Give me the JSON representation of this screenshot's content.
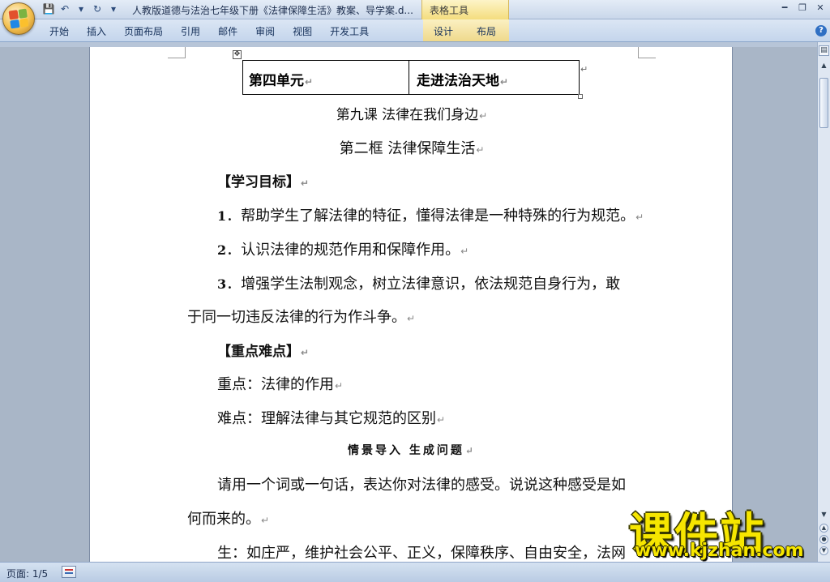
{
  "window": {
    "title": "人教版道德与法治七年级下册《法律保障生活》教案、导学案.d...",
    "context_tab_group": "表格工具"
  },
  "ribbon": {
    "tabs": [
      "开始",
      "插入",
      "页面布局",
      "引用",
      "邮件",
      "审阅",
      "视图",
      "开发工具"
    ],
    "context_tabs": [
      "设计",
      "布局"
    ]
  },
  "document": {
    "table": {
      "cell1": "第四单元",
      "cell2": "走进法治天地"
    },
    "lesson": "第九课  法律在我们身边",
    "frame": "第二框  法律保障生活",
    "objectives_heading": "【学习目标】",
    "objectives": [
      {
        "num": "1",
        "text": "．帮助学生了解法律的特征，懂得法律是一种特殊的行为规范。"
      },
      {
        "num": "2",
        "text": "．认识法律的规范作用和保障作用。"
      },
      {
        "num": "3",
        "text": "．增强学生法制观念，树立法律意识，依法规范自身行为，敢"
      }
    ],
    "objective3_cont": "于同一切违反法律的行为作斗争。",
    "key_heading": "【重点难点】",
    "key_point": "重点：法律的作用",
    "difficulty": "难点：理解法律与其它规范的区别",
    "scene_heading": "情景导入  生成问题",
    "prompt_line1": "请用一个词或一句话，表达你对法律的感受。说说这种感受是如",
    "prompt_line2": "何而来的。",
    "student_answer": "生：如庄严，维护社会公平、正义，保障秩序、自由安全，法网"
  },
  "status": {
    "page": "页面: 1/5"
  },
  "watermark": {
    "title": "课件站",
    "url": "www.kjzhan.com"
  },
  "colors": {
    "ribbon": "#c4d5ec",
    "context_tab": "#f4dd7e",
    "workspace": "#a9b6c7",
    "watermark": "#f6e600"
  }
}
